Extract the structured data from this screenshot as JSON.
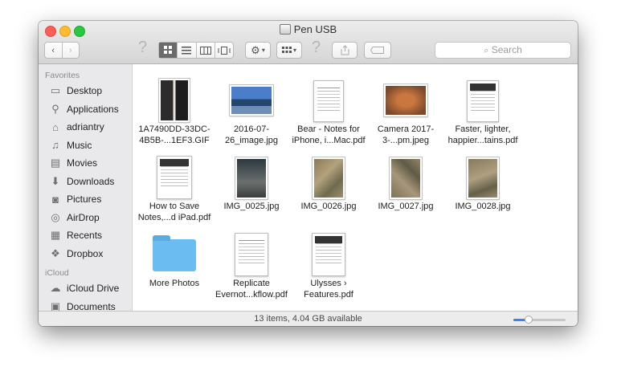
{
  "window": {
    "title": "Pen USB"
  },
  "toolbar": {
    "back_icon": "chevron-left-icon",
    "forward_icon": "chevron-right-icon",
    "help_glyph": "?",
    "view_modes": [
      "icon-view",
      "list-view",
      "column-view",
      "cover-flow-view"
    ],
    "active_view": "icon-view",
    "action_icon": "gear-icon",
    "arrange_icon": "arrange-grid-icon",
    "share_icon": "share-icon",
    "tags_icon": "tag-icon"
  },
  "search": {
    "placeholder": "Search"
  },
  "sidebar": {
    "sections": [
      {
        "header": "Favorites",
        "items": [
          {
            "label": "Desktop",
            "icon": "desktop-icon"
          },
          {
            "label": "Applications",
            "icon": "applications-icon"
          },
          {
            "label": "adriantry",
            "icon": "home-icon"
          },
          {
            "label": "Music",
            "icon": "music-icon"
          },
          {
            "label": "Movies",
            "icon": "movies-icon"
          },
          {
            "label": "Downloads",
            "icon": "downloads-icon"
          },
          {
            "label": "Pictures",
            "icon": "pictures-icon"
          },
          {
            "label": "AirDrop",
            "icon": "airdrop-icon"
          },
          {
            "label": "Recents",
            "icon": "recents-icon"
          },
          {
            "label": "Dropbox",
            "icon": "dropbox-icon"
          }
        ]
      },
      {
        "header": "iCloud",
        "items": [
          {
            "label": "iCloud Drive",
            "icon": "cloud-icon"
          },
          {
            "label": "Documents",
            "icon": "documents-icon"
          }
        ]
      }
    ]
  },
  "files": [
    {
      "name": "1A7490DD-33DC-4B5B-...1EF3.GIF",
      "kind": "photo"
    },
    {
      "name": "2016-07-26_image.jpg",
      "kind": "photo"
    },
    {
      "name": "Bear - Notes for iPhone, i...Mac.pdf",
      "kind": "doc"
    },
    {
      "name": "Camera 2017-3-...pm.jpeg",
      "kind": "photo"
    },
    {
      "name": "Faster, lighter, happier...tains.pdf",
      "kind": "doc"
    },
    {
      "name": "How to Save Notes,...d iPad.pdf",
      "kind": "doc"
    },
    {
      "name": "IMG_0025.jpg",
      "kind": "photo"
    },
    {
      "name": "IMG_0026.jpg",
      "kind": "photo"
    },
    {
      "name": "IMG_0027.jpg",
      "kind": "photo"
    },
    {
      "name": "IMG_0028.jpg",
      "kind": "photo"
    },
    {
      "name": "More Photos",
      "kind": "folder"
    },
    {
      "name": "Replicate Evernot...kflow.pdf",
      "kind": "doc"
    },
    {
      "name": "Ulysses › Features.pdf",
      "kind": "doc"
    }
  ],
  "status": {
    "text": "13 items, 4.04 GB available",
    "icon_size_level": 0.25
  },
  "colors": {
    "close": "#fc5f57",
    "minimize": "#fdbc2e",
    "maximize": "#28c840",
    "folder": "#6bbdf1",
    "accent": "#3b82f6"
  }
}
